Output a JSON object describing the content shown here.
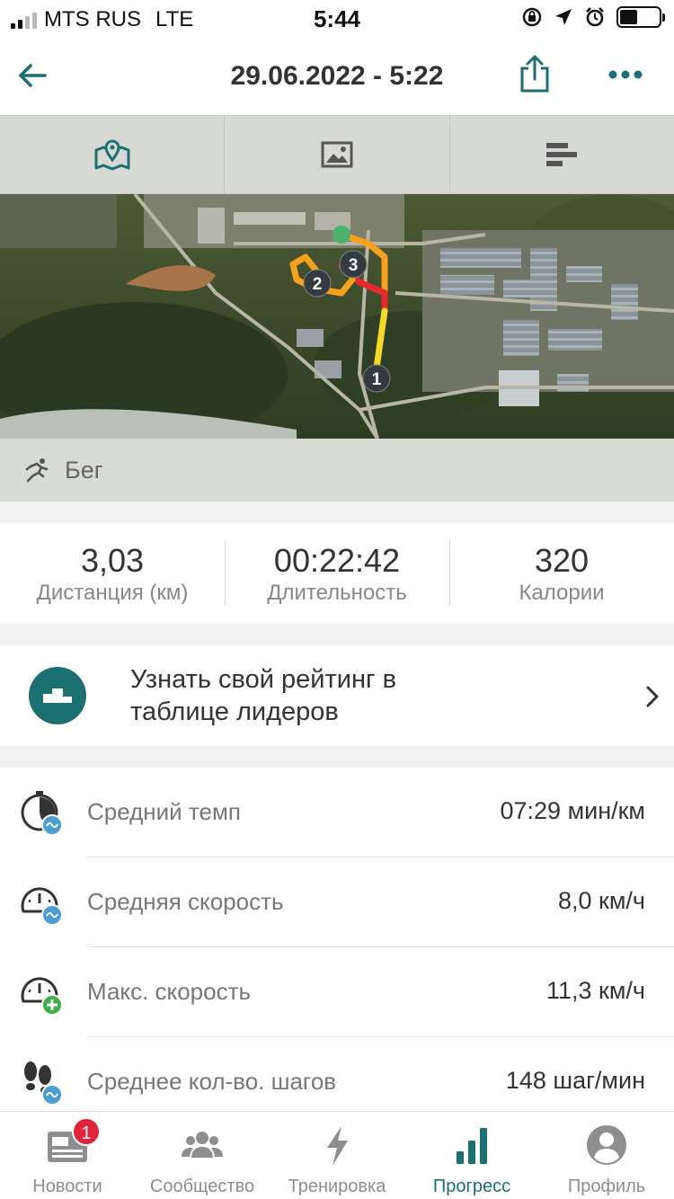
{
  "status_bar": {
    "carrier": "MTS RUS",
    "network": "LTE",
    "time": "5:44",
    "battery_level": 0.45
  },
  "header": {
    "title": "29.06.2022 - 5:22"
  },
  "tabs": [
    {
      "name": "map",
      "icon": "map-icon",
      "active": true
    },
    {
      "name": "photos",
      "icon": "image-icon",
      "active": false
    },
    {
      "name": "charts",
      "icon": "bars-icon",
      "active": false
    }
  ],
  "map": {
    "markers": [
      "1",
      "2",
      "3"
    ],
    "route_colors": [
      "#f5e52a",
      "#f7a21c",
      "#e8292b"
    ],
    "start_color": "#4cb26e"
  },
  "activity": {
    "icon": "running-icon",
    "label": "Бег"
  },
  "summary": [
    {
      "value": "3,03",
      "label": "Дистанция (км)"
    },
    {
      "value": "00:22:42",
      "label": "Длительность"
    },
    {
      "value": "320",
      "label": "Калории"
    }
  ],
  "leaderboard": {
    "icon": "podium-icon",
    "line1": "Узнать свой рейтинг в",
    "line2": "таблице лидеров"
  },
  "metrics": [
    {
      "icon": "stopwatch-avg-icon",
      "label": "Средний темп",
      "value": "07:29 мин/км"
    },
    {
      "icon": "speedometer-avg-icon",
      "label": "Средняя скорость",
      "value": "8,0 км/ч"
    },
    {
      "icon": "speedometer-max-icon",
      "label": "Макс. скорость",
      "value": "11,3 км/ч"
    },
    {
      "icon": "footsteps-avg-icon",
      "label": "Среднее кол-во. шагов",
      "value": "148 шаг/мин"
    }
  ],
  "tabbar": [
    {
      "label": "Новости",
      "icon": "news-icon",
      "badge": "1",
      "active": false
    },
    {
      "label": "Сообщество",
      "icon": "community-icon",
      "active": false
    },
    {
      "label": "Тренировка",
      "icon": "lightning-icon",
      "active": false
    },
    {
      "label": "Прогресс",
      "icon": "progress-bars-icon",
      "active": true
    },
    {
      "label": "Профиль",
      "icon": "profile-icon",
      "active": false
    }
  ],
  "colors": {
    "accent": "#1c7071",
    "badge": "#e0243c",
    "metric_icon_blue": "#4a9fd0",
    "metric_icon_green": "#3fae49"
  }
}
